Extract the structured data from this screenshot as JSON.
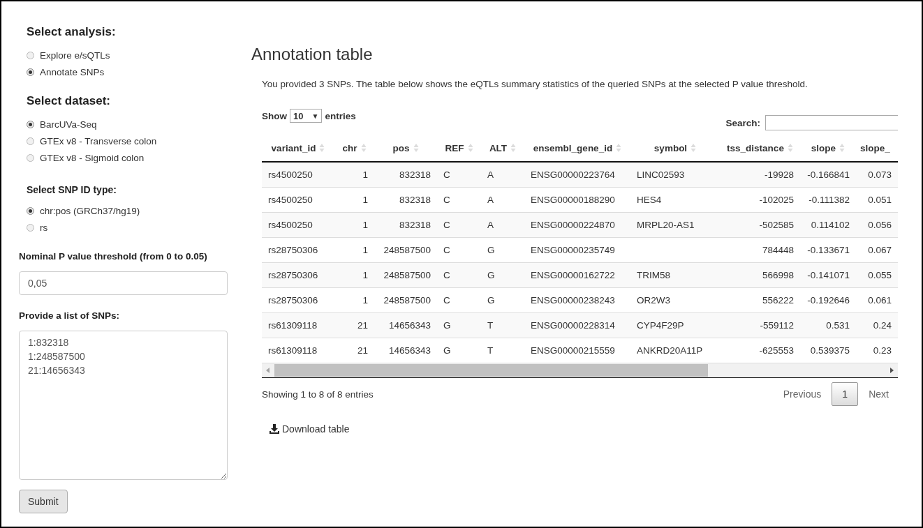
{
  "sidebar": {
    "analysis": {
      "heading": "Select analysis:",
      "options": [
        {
          "label": "Explore e/sQTLs",
          "selected": false
        },
        {
          "label": "Annotate SNPs",
          "selected": true
        }
      ]
    },
    "dataset": {
      "heading": "Select dataset:",
      "options": [
        {
          "label": "BarcUVa-Seq",
          "selected": true
        },
        {
          "label": "GTEx v8 - Transverse colon",
          "selected": false
        },
        {
          "label": "GTEx v8 - Sigmoid colon",
          "selected": false
        }
      ]
    },
    "id_type": {
      "heading": "Select SNP ID type:",
      "options": [
        {
          "label": "chr:pos (GRCh37/hg19)",
          "selected": true
        },
        {
          "label": "rs",
          "selected": false
        }
      ]
    },
    "threshold": {
      "label": "Nominal P value threshold (from 0 to 0.05)",
      "value": "0,05"
    },
    "snp_list": {
      "label": "Provide a list of SNPs:",
      "value": "1:832318\n1:248587500\n21:14656343"
    },
    "submit": "Submit"
  },
  "main": {
    "title": "Annotation table",
    "intro": "You provided 3 SNPs. The table below shows the eQTLs summary statistics of the queried SNPs at the selected P value threshold.",
    "length": {
      "before": "Show",
      "value": "10",
      "caret": "▼",
      "after": "entries"
    },
    "search": {
      "label": "Search:"
    },
    "table": {
      "columns": [
        "variant_id",
        "chr",
        "pos",
        "REF",
        "ALT",
        "ensembl_gene_id",
        "symbol",
        "tss_distance",
        "slope",
        "slope_"
      ],
      "rows": [
        [
          "rs4500250",
          "1",
          "832318",
          "C",
          "A",
          "ENSG00000223764",
          "LINC02593",
          "-19928",
          "-0.166841",
          "0.073"
        ],
        [
          "rs4500250",
          "1",
          "832318",
          "C",
          "A",
          "ENSG00000188290",
          "HES4",
          "-102025",
          "-0.111382",
          "0.051"
        ],
        [
          "rs4500250",
          "1",
          "832318",
          "C",
          "A",
          "ENSG00000224870",
          "MRPL20-AS1",
          "-502585",
          "0.114102",
          "0.056"
        ],
        [
          "rs28750306",
          "1",
          "248587500",
          "C",
          "G",
          "ENSG00000235749",
          "",
          "784448",
          "-0.133671",
          "0.067"
        ],
        [
          "rs28750306",
          "1",
          "248587500",
          "C",
          "G",
          "ENSG00000162722",
          "TRIM58",
          "566998",
          "-0.141071",
          "0.055"
        ],
        [
          "rs28750306",
          "1",
          "248587500",
          "C",
          "G",
          "ENSG00000238243",
          "OR2W3",
          "556222",
          "-0.192646",
          "0.061"
        ],
        [
          "rs61309118",
          "21",
          "14656343",
          "G",
          "T",
          "ENSG00000228314",
          "CYP4F29P",
          "-559112",
          "0.531",
          "0.24"
        ],
        [
          "rs61309118",
          "21",
          "14656343",
          "G",
          "T",
          "ENSG00000215559",
          "ANKRD20A11P",
          "-625553",
          "0.539375",
          "0.23"
        ]
      ]
    },
    "info": "Showing 1 to 8 of 8 entries",
    "pagination": [
      {
        "label": "Previous",
        "kind": "nav",
        "selected": false
      },
      {
        "label": "1",
        "kind": "page",
        "selected": true
      },
      {
        "label": "Next",
        "kind": "nav",
        "selected": false
      }
    ],
    "download": "Download table"
  }
}
